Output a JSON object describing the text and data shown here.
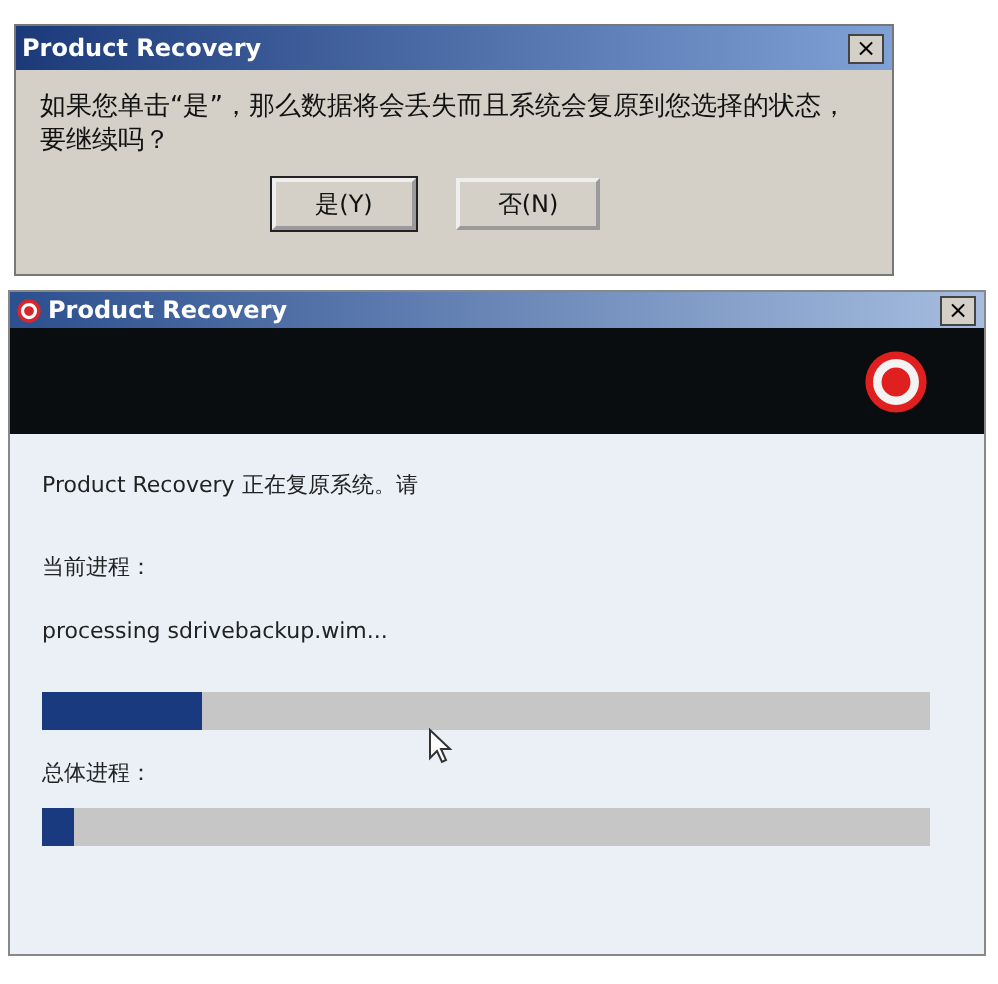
{
  "confirm_dialog": {
    "title": "Product Recovery",
    "close": "×",
    "message": "如果您单击“是”，那么数据将会丢失而且系统会复原到您选择的状态，要继续吗？",
    "buttons": [
      {
        "label": "是(Y)",
        "focused": true
      },
      {
        "label": "否(N)",
        "focused": false
      }
    ]
  },
  "progress_window": {
    "title": "Product Recovery",
    "close": "×",
    "status": "Product Recovery 正在复原系统。请",
    "current_label": "当前进程：",
    "current_item": "processing sdrivebackup.wim...",
    "current_progress": {
      "level": 0.18
    },
    "overall_label": "总体进程：",
    "overall_progress": {
      "level": 0.035
    }
  }
}
